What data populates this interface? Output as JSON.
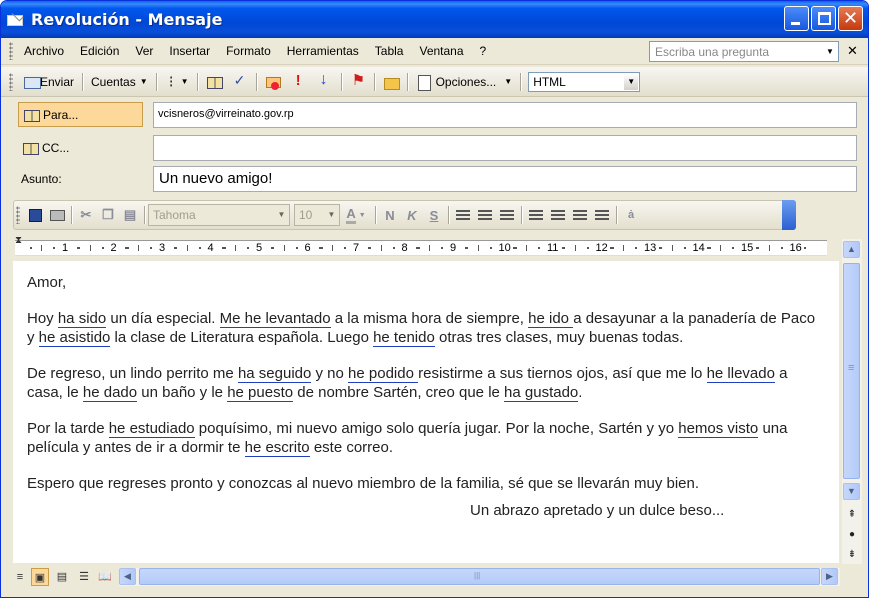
{
  "window": {
    "title": "Revolución - Mensaje"
  },
  "menu": {
    "items": [
      {
        "label": "Archivo"
      },
      {
        "label": "Edición"
      },
      {
        "label": "Ver"
      },
      {
        "label": "Insertar"
      },
      {
        "label": "Formato"
      },
      {
        "label": "Herramientas"
      },
      {
        "label": "Tabla"
      },
      {
        "label": "Ventana"
      },
      {
        "label": "?"
      }
    ],
    "ask_placeholder": "Escriba una pregunta"
  },
  "toolbar": {
    "send_label": "Enviar",
    "accounts_label": "Cuentas",
    "options_label": "Opciones...",
    "format_value": "HTML",
    "icons": [
      "send-icon",
      "attach-icon",
      "address-book-icon",
      "check-names-icon",
      "permission-icon",
      "high-importance-icon",
      "low-importance-icon",
      "flag-icon",
      "folder-icon",
      "options-icon"
    ]
  },
  "header": {
    "to_label": "Para...",
    "to_value": "vcisneros@virreinato.gov.rp",
    "cc_label": "CC...",
    "cc_value": "",
    "subject_label": "Asunto:",
    "subject_value": "Un nuevo amigo!"
  },
  "formatting": {
    "font": "Tahoma",
    "size": "10"
  },
  "ruler": {
    "numbers": [
      "1",
      "2",
      "3",
      "4",
      "5",
      "6",
      "7",
      "8",
      "9",
      "10",
      "11",
      "12",
      "13",
      "14",
      "15",
      "16"
    ]
  },
  "document": {
    "greeting": "Amor,",
    "p1": [
      {
        "t": "Hoy "
      },
      {
        "t": "ha sido",
        "v": true
      },
      {
        "t": " un día especial. "
      },
      {
        "t": "Me he levantado",
        "v": true
      },
      {
        "t": " a la misma hora de siempre, "
      },
      {
        "t": "he ido ",
        "v": true
      },
      {
        "t": "a desayunar a la panadería de Paco y "
      },
      {
        "t": "he asistido",
        "v": true
      },
      {
        "t": " la clase de Literatura española. Luego "
      },
      {
        "t": "he tenido",
        "v": true
      },
      {
        "t": " otras tres clases, muy buenas todas."
      }
    ],
    "p2": [
      {
        "t": "De regreso, un lindo perrito me "
      },
      {
        "t": "ha seguido",
        "v": true
      },
      {
        "t": " y no "
      },
      {
        "t": "he podido ",
        "v": true
      },
      {
        "t": "resistirme a sus tiernos ojos, así que me lo "
      },
      {
        "t": "he llevado",
        "v": true
      },
      {
        "t": " a casa, le "
      },
      {
        "t": "he dado",
        "v": true
      },
      {
        "t": " un baño y le "
      },
      {
        "t": "he puesto",
        "v": true
      },
      {
        "t": " de nombre Sartén, creo que le "
      },
      {
        "t": "ha gustado",
        "v": true
      },
      {
        "t": "."
      }
    ],
    "p3": [
      {
        "t": "Por la tarde "
      },
      {
        "t": "he estudiado",
        "v": true
      },
      {
        "t": " poquísimo, mi nuevo amigo solo quería jugar. Por la noche, Sartén y yo "
      },
      {
        "t": "hemos visto",
        "v": true
      },
      {
        "t": " una película y antes de ir a dormir te "
      },
      {
        "t": "he escrito",
        "v": true
      },
      {
        "t": " este correo."
      }
    ],
    "p4": "Espero que regreses pronto y conozcas al nuevo miembro de la familia, sé que se llevarán muy bien.",
    "closing": "Un abrazo apretado y un dulce beso..."
  },
  "colors": {
    "titlebar": "#0047d6",
    "verb_underline": "#2040c0",
    "pressed": "#fcd89a"
  }
}
